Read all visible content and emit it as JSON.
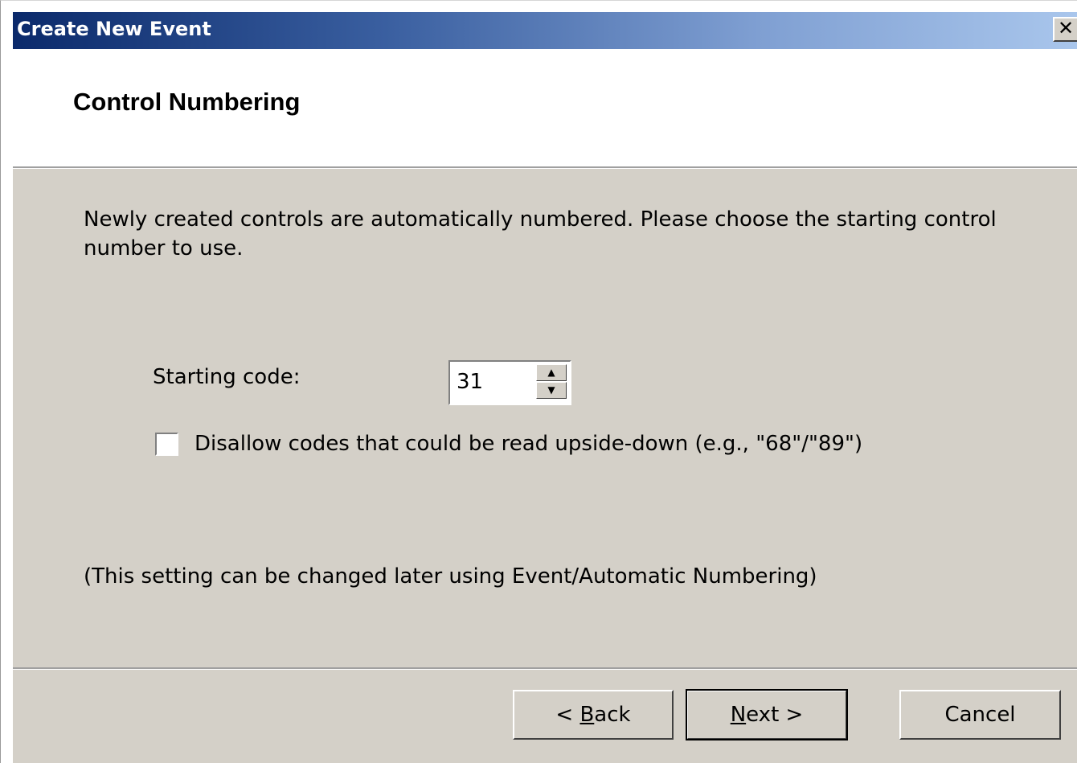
{
  "window": {
    "title": "Create New Event",
    "close_glyph": "✕"
  },
  "header": {
    "title": "Control Numbering"
  },
  "body": {
    "description": "Newly created controls are automatically numbered. Please choose the starting control number to use.",
    "starting_code_label": "Starting code:",
    "starting_code_value": "31",
    "spin_up_glyph": "▲",
    "spin_down_glyph": "▼",
    "disallow_checkbox_label": "Disallow codes that could be read upside-down (e.g., \"68\"/\"89\")",
    "disallow_checked": false,
    "note": "(This setting can be changed later using Event/Automatic Numbering)"
  },
  "buttons": {
    "back_prefix": "< ",
    "back_mnemonic": "B",
    "back_rest": "ack",
    "next_mnemonic": "N",
    "next_rest": "ext >",
    "cancel": "Cancel"
  }
}
